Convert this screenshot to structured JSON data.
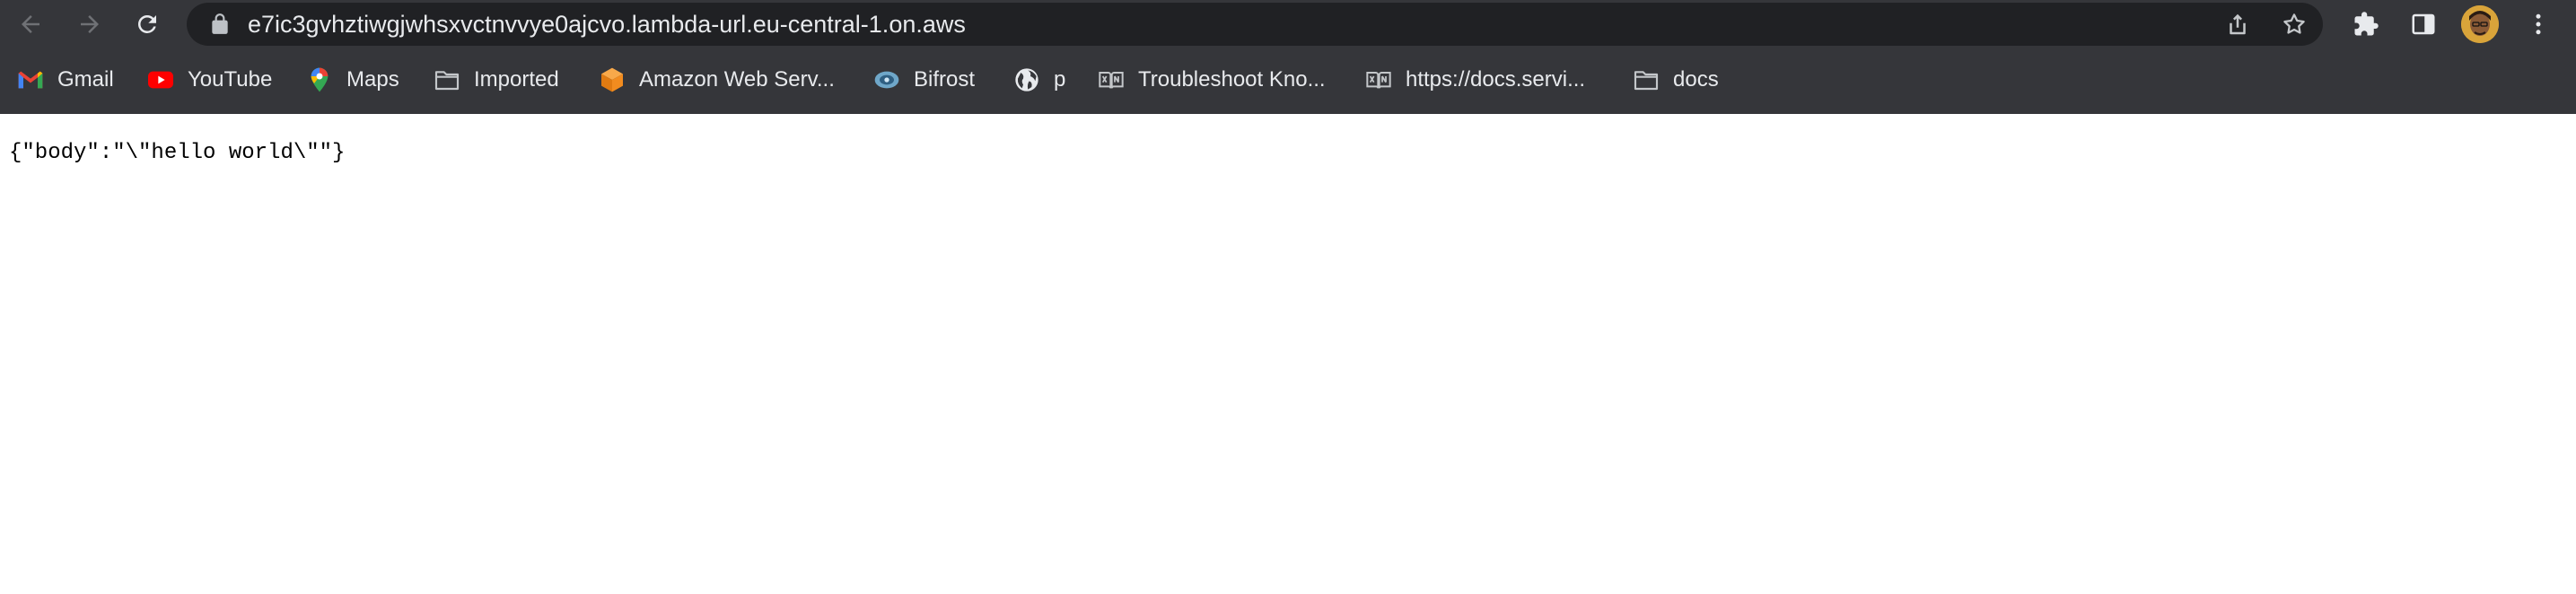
{
  "browser": {
    "url": "e7ic3gvhztiwgjwhsxvctnvvye0ajcvo.lambda-url.eu-central-1.on.aws"
  },
  "icons": {
    "back": "arrow-left-icon",
    "forward": "arrow-right-icon",
    "reload": "reload-icon",
    "lock": "lock-icon",
    "share": "share-icon",
    "bookmark_star": "star-icon",
    "extensions": "puzzle-icon",
    "side_panel": "side-panel-icon",
    "menu": "kebab-menu-icon"
  },
  "bookmarks": [
    {
      "label": "Gmail",
      "icon": "gmail-icon"
    },
    {
      "label": "YouTube",
      "icon": "youtube-icon"
    },
    {
      "label": "Maps",
      "icon": "maps-pin-icon"
    },
    {
      "label": "Imported",
      "icon": "folder-icon"
    },
    {
      "label": "Amazon Web Serv...",
      "icon": "aws-cube-icon"
    },
    {
      "label": "Bifrost",
      "icon": "bifrost-icon"
    },
    {
      "label": "p",
      "icon": "globe-icon"
    },
    {
      "label": "Troubleshoot Kno...",
      "icon": "book-icon"
    },
    {
      "label": "https://docs.servi...",
      "icon": "book-icon"
    },
    {
      "label": "docs",
      "icon": "folder-icon"
    }
  ],
  "page": {
    "body_text": "{\"body\":\"\\\"hello world\\\"\"}"
  },
  "colors": {
    "chrome_bg": "#35363a",
    "omnibox_bg": "#202124",
    "text_light": "#e8eaed",
    "page_bg": "#ffffff"
  }
}
